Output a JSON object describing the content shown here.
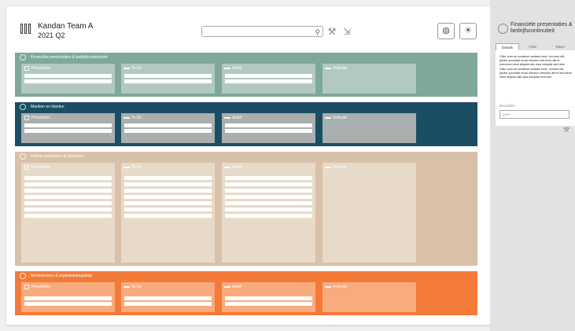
{
  "app": {
    "team": "Kandan Team A",
    "period": "2021 Q2"
  },
  "search": {
    "placeholder": ""
  },
  "colors": {
    "finance": "#7ea89a",
    "finance_col": "#b2c9c0",
    "market": "#1b4e64",
    "market_col": "#a9aeae",
    "intern": "#d9c0a8",
    "intern_col": "#e8dac8",
    "people": "#f47a3a",
    "people_col": "#f8ab7d"
  },
  "columns": {
    "prio": "Prioriteiten",
    "todo": "To Do",
    "actief": "Actief",
    "voltooid": "Voltooid"
  },
  "sections": [
    {
      "title": "Financiële presentaties & bedrijfscontinuïteit"
    },
    {
      "title": "Markten en klanten"
    },
    {
      "title": "Interne processen & systemen"
    },
    {
      "title": "Medewerkers & organisatiekapitaal"
    }
  ],
  "sidebar": {
    "title": "Financiële presentaties & bedrijfscontinuiteit",
    "tabs": [
      "Details",
      "Chat",
      "Taken"
    ],
    "description": "Cillor sum se occabore audaes nest, om-mos elit, quiam quundae enda nimusci unti-ones alit et omnolum iume aliques alis ulpa voluptat vent lam Cillor sum se occabore audaes nest, ommos elit, quiam quundae enda nimusci untiones alit et omnolum iume aliques alis ulpa voluptat vent lam",
    "besc_label": "Beoorden",
    "besc_value": "geen"
  }
}
